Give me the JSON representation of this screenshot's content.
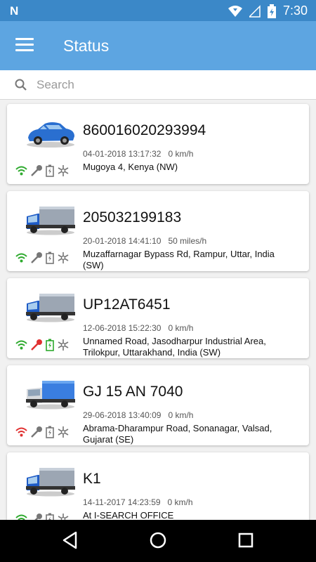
{
  "status_bar": {
    "time": "7:30"
  },
  "app_bar": {
    "title": "Status"
  },
  "search": {
    "placeholder": "Search"
  },
  "colors": {
    "status_bar": "#3b88c8",
    "app_bar": "#5da5e1",
    "signal_good": "#2eaa2e",
    "signal_bad": "#e03030",
    "ignition_on": "#e03030",
    "battery_ok": "#2eaa2e"
  },
  "vehicles": [
    {
      "id": "860016020293994",
      "datetime": "04-01-2018 13:17:32",
      "speed": "0 km/h",
      "address": "Mugoya 4, Kenya (NW)",
      "type": "car-icon"
    },
    {
      "id": "205032199183",
      "datetime": "20-01-2018 14:41:10",
      "speed": "50 miles/h",
      "address": "Muzaffarnagar Bypass Rd, Rampur, Uttar,  India (SW)",
      "type": "truck-icon"
    },
    {
      "id": "UP12AT6451",
      "datetime": "12-06-2018 15:22:30",
      "speed": "0 km/h",
      "address": "Unnamed Road, Jasodharpur Industrial Area, Trilokpur, Uttarakhand,  India (SW)",
      "type": "truck-icon"
    },
    {
      "id": "GJ 15 AN 7040",
      "datetime": "29-06-2018 13:40:09",
      "speed": "0 km/h",
      "address": "Abrama-Dharampur Road, Sonanagar, Valsad, Gujarat (SE)",
      "type": "lorry-icon"
    },
    {
      "id": "K1",
      "datetime": "14-11-2017 14:23:59",
      "speed": "0 km/h",
      "address": "At I-SEARCH OFFICE",
      "type": "truck-icon"
    }
  ]
}
